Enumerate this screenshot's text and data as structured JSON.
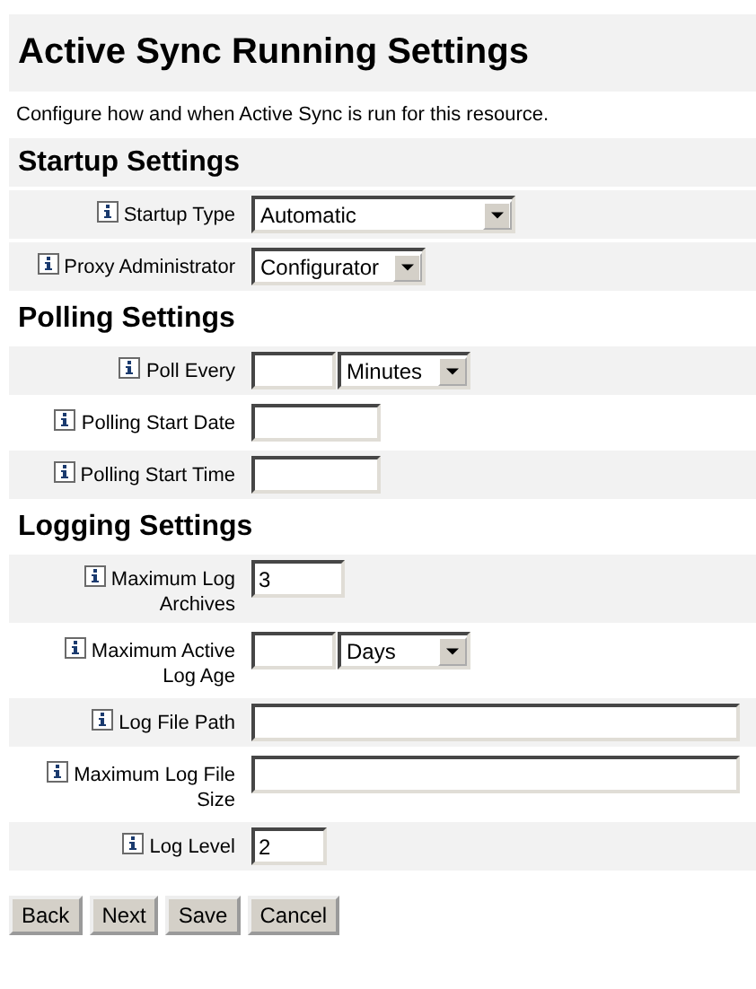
{
  "title": "Active Sync Running Settings",
  "description": "Configure how and when Active Sync is run for this resource.",
  "sections": [
    {
      "heading": "Startup Settings",
      "shaded": true,
      "rows": [
        {
          "label": "Startup Type",
          "shaded": true,
          "kind": "select_wide",
          "value": "Automatic"
        },
        {
          "label": "Proxy Administrator",
          "shaded": true,
          "kind": "select",
          "value": "Configurator"
        }
      ]
    },
    {
      "heading": "Polling Settings",
      "shaded": false,
      "rows": [
        {
          "label": "Poll Every",
          "shaded": true,
          "kind": "number_unit",
          "unit": "Minutes"
        },
        {
          "label": "Polling Start Date",
          "shaded": false,
          "kind": "text"
        },
        {
          "label": "Polling Start Time",
          "shaded": true,
          "kind": "text"
        }
      ]
    },
    {
      "heading": "Logging Settings",
      "shaded": false,
      "rows": [
        {
          "label": "Maximum Log Archives",
          "shaded": true,
          "kind": "text_short",
          "value": "3"
        },
        {
          "label": "Maximum Active Log Age",
          "shaded": false,
          "kind": "number_unit",
          "unit": "Days"
        },
        {
          "label": "Log File Path",
          "shaded": true,
          "kind": "text_long"
        },
        {
          "label": "Maximum Log File Size",
          "shaded": false,
          "kind": "text_long"
        },
        {
          "label": "Log Level",
          "shaded": true,
          "kind": "text_tiny",
          "value": "2"
        }
      ]
    }
  ],
  "buttons": [
    "Back",
    "Next",
    "Save",
    "Cancel"
  ]
}
